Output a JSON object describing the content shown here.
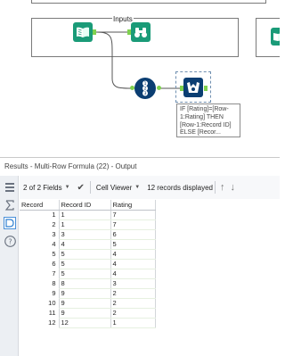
{
  "canvas": {
    "container_title": "Inputs",
    "annotation": "IF [Rating]=[Row-\n1:Rating] THEN\n[Row-1:Record ID]\nELSE [Recor..."
  },
  "results": {
    "title": "Results - Multi-Row Formula (22) - Output",
    "fields_label": "2 of 2 Fields",
    "viewer_label": "Cell Viewer",
    "records_displayed": "12 records displayed",
    "columns": [
      "Record",
      "Record ID",
      "Rating"
    ],
    "rows": [
      [
        "1",
        "1",
        "7"
      ],
      [
        "2",
        "1",
        "7"
      ],
      [
        "3",
        "3",
        "6"
      ],
      [
        "4",
        "4",
        "5"
      ],
      [
        "5",
        "5",
        "4"
      ],
      [
        "6",
        "5",
        "4"
      ],
      [
        "7",
        "5",
        "4"
      ],
      [
        "8",
        "8",
        "3"
      ],
      [
        "9",
        "9",
        "2"
      ],
      [
        "10",
        "9",
        "2"
      ],
      [
        "11",
        "9",
        "2"
      ],
      [
        "12",
        "12",
        "1"
      ]
    ]
  },
  "icons": {
    "input": "book-icon",
    "browse": "binoculars-icon",
    "record_id": "record-id-icon",
    "multi_row": "multi-row-formula-icon",
    "check": "check-icon",
    "up": "arrow-up-icon",
    "down": "arrow-down-icon"
  },
  "colors": {
    "input_tool": "#1a9b78",
    "formula_tool": "#0b3e72",
    "anchor": "#7fd14e",
    "grid_header": "#ffffff"
  }
}
